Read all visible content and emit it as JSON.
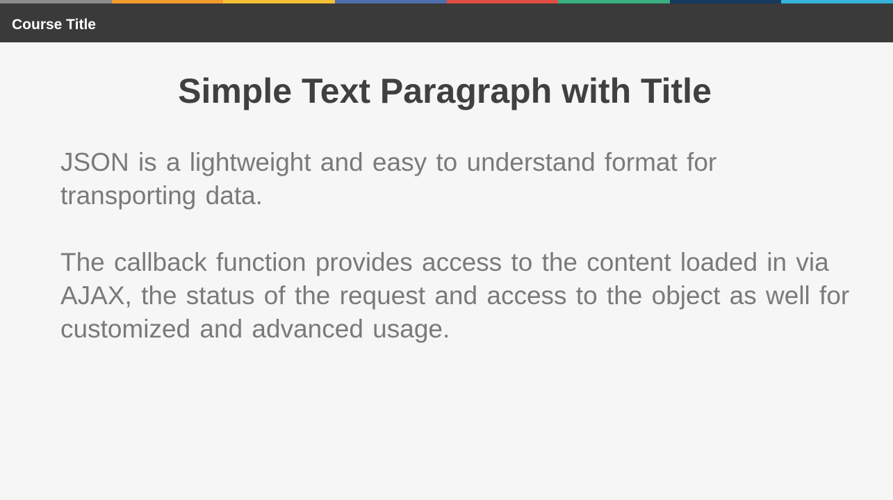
{
  "header": {
    "course_title": "Course Title",
    "stripe_colors": [
      "#8c8c8c",
      "#f39a2f",
      "#f5c033",
      "#4f6eac",
      "#e04e43",
      "#3aae82",
      "#173a5e",
      "#36b2dc"
    ]
  },
  "slide": {
    "title": "Simple Text Paragraph with Title",
    "paragraphs": [
      "JSON is a lightweight and easy to understand format for transporting data.",
      "The callback function provides access to the content loaded in via AJAX, the status of the request and access to the object as well for customized and advanced usage."
    ]
  },
  "colors": {
    "header_bar": "#3a3a3a",
    "background": "#f6f6f6",
    "title_text": "#404040",
    "body_text": "#7a7a7a"
  }
}
